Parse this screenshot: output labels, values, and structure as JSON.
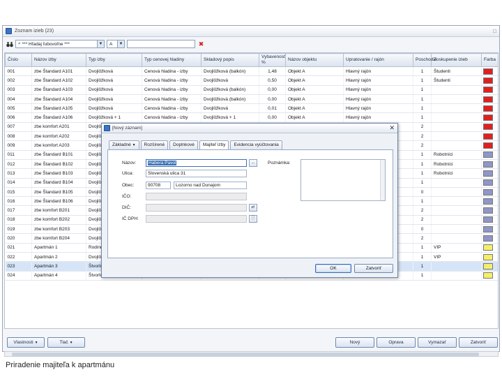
{
  "window": {
    "title": "Zoznam izieb (23)"
  },
  "toolbar": {
    "search_placeholder": "*** Hľadaj ľubovoľne ***",
    "filter_value": "A"
  },
  "grid": {
    "columns": [
      "Číslo",
      "Názov izby",
      "Typ izby",
      "Typ cenovej hladiny",
      "Skladový popis",
      "Vybavenosť %",
      "Názov objektu",
      "Upratovanie / rajón",
      "Poschodie",
      "Zoskupenie izieb",
      "Farba"
    ],
    "rows": [
      {
        "cislo": "001",
        "nazov": "zbe Štandard A101",
        "typ": "Dvojlôžková",
        "cenova": "Cenová hladina - izby",
        "popis": "Dvojlôžková (balkón)",
        "vybav": "1,48",
        "objekt": "Objekt A",
        "rajon": "Hlavný rajón",
        "posch": "1",
        "zosk": "Študenti",
        "farba": "#e02020"
      },
      {
        "cislo": "002",
        "nazov": "zbe Štandard A102",
        "typ": "Dvojlôžková",
        "cenova": "Cenová hladina - izby",
        "popis": "Dvojlôžková",
        "vybav": "0,50",
        "objekt": "Objekt A",
        "rajon": "Hlavný rajón",
        "posch": "1",
        "zosk": "Študenti",
        "farba": "#e02020"
      },
      {
        "cislo": "003",
        "nazov": "zbe Štandard A103",
        "typ": "Dvojlôžková",
        "cenova": "Cenová hladina - izby",
        "popis": "Dvojlôžková (balkón)",
        "vybav": "0,00",
        "objekt": "Objekt A",
        "rajon": "Hlavný rajón",
        "posch": "1",
        "zosk": "",
        "farba": "#e02020"
      },
      {
        "cislo": "004",
        "nazov": "zbe Štandard A104",
        "typ": "Dvojlôžková",
        "cenova": "Cenová hladina - izby",
        "popis": "Dvojlôžková (balkón)",
        "vybav": "0,00",
        "objekt": "Objekt A",
        "rajon": "Hlavný rajón",
        "posch": "1",
        "zosk": "",
        "farba": "#e02020"
      },
      {
        "cislo": "005",
        "nazov": "zbe Štandard A105",
        "typ": "Dvojlôžková",
        "cenova": "Cenová hladina - izby",
        "popis": "Dvojlôžková",
        "vybav": "0,01",
        "objekt": "Objekt A",
        "rajon": "Hlavný rajón",
        "posch": "1",
        "zosk": "",
        "farba": "#e02020"
      },
      {
        "cislo": "006",
        "nazov": "zbe Štandard A106",
        "typ": "Dvojlôžková + 1",
        "cenova": "Cenová hladina - izby",
        "popis": "Dvojlôžková + 1",
        "vybav": "0,00",
        "objekt": "Objekt A",
        "rajon": "Hlavný rajón",
        "posch": "1",
        "zosk": "",
        "farba": "#e02020"
      },
      {
        "cislo": "007",
        "nazov": "zbe komfort A201",
        "typ": "Dvojlôžková",
        "cenova": "",
        "popis": "",
        "vybav": "",
        "objekt": "",
        "rajon": "",
        "posch": "2",
        "zosk": "",
        "farba": "#e02020"
      },
      {
        "cislo": "008",
        "nazov": "zbe komfort A202",
        "typ": "Dvojlôžková",
        "cenova": "",
        "popis": "",
        "vybav": "",
        "objekt": "",
        "rajon": "",
        "posch": "2",
        "zosk": "",
        "farba": "#e02020"
      },
      {
        "cislo": "009",
        "nazov": "zbe komfort A203",
        "typ": "Dvojlôžková",
        "cenova": "",
        "popis": "",
        "vybav": "",
        "objekt": "",
        "rajon": "",
        "posch": "2",
        "zosk": "",
        "farba": "#e02020"
      },
      {
        "cislo": "011",
        "nazov": "zbe Štandard B101",
        "typ": "Dvojlôžková",
        "cenova": "",
        "popis": "",
        "vybav": "",
        "objekt": "",
        "rajon": "",
        "posch": "1",
        "zosk": "Robotníci",
        "farba": "#8f96c8"
      },
      {
        "cislo": "012",
        "nazov": "zbe Štandard B102",
        "typ": "Dvojlôžková",
        "cenova": "",
        "popis": "",
        "vybav": "",
        "objekt": "",
        "rajon": "",
        "posch": "1",
        "zosk": "Robotníci",
        "farba": "#8f96c8"
      },
      {
        "cislo": "013",
        "nazov": "zbe Štandard B103",
        "typ": "Dvojlôžková",
        "cenova": "",
        "popis": "",
        "vybav": "",
        "objekt": "",
        "rajon": "",
        "posch": "1",
        "zosk": "Robotníci",
        "farba": "#8f96c8"
      },
      {
        "cislo": "014",
        "nazov": "zbe Štandard B104",
        "typ": "Dvojlôžková",
        "cenova": "",
        "popis": "",
        "vybav": "",
        "objekt": "",
        "rajon": "",
        "posch": "1",
        "zosk": "",
        "farba": "#8f96c8"
      },
      {
        "cislo": "015",
        "nazov": "zbe Štandard B105",
        "typ": "Dvojlôžková",
        "cenova": "",
        "popis": "",
        "vybav": "",
        "objekt": "",
        "rajon": "",
        "posch": "0",
        "zosk": "",
        "farba": "#8f96c8"
      },
      {
        "cislo": "016",
        "nazov": "zbe Štandard B106",
        "typ": "Dvojlôžková",
        "cenova": "",
        "popis": "",
        "vybav": "",
        "objekt": "",
        "rajon": "",
        "posch": "1",
        "zosk": "",
        "farba": "#8f96c8"
      },
      {
        "cislo": "017",
        "nazov": "zbe komfort B201",
        "typ": "Dvojlôžková",
        "cenova": "",
        "popis": "",
        "vybav": "",
        "objekt": "",
        "rajon": "",
        "posch": "2",
        "zosk": "",
        "farba": "#8f96c8"
      },
      {
        "cislo": "018",
        "nazov": "zbe komfort B202",
        "typ": "Dvojlôžková",
        "cenova": "",
        "popis": "",
        "vybav": "",
        "objekt": "",
        "rajon": "",
        "posch": "2",
        "zosk": "",
        "farba": "#8f96c8"
      },
      {
        "cislo": "019",
        "nazov": "zbe komfort B203",
        "typ": "Dvojlôžková",
        "cenova": "",
        "popis": "",
        "vybav": "",
        "objekt": "",
        "rajon": "",
        "posch": "0",
        "zosk": "",
        "farba": "#8f96c8"
      },
      {
        "cislo": "020",
        "nazov": "zbe komfort B204",
        "typ": "Dvojlôžková",
        "cenova": "",
        "popis": "",
        "vybav": "",
        "objekt": "",
        "rajon": "",
        "posch": "2",
        "zosk": "",
        "farba": "#8f96c8"
      },
      {
        "cislo": "021",
        "nazov": "Apartmán 1",
        "typ": "Rodinná",
        "cenova": "",
        "popis": "",
        "vybav": "",
        "objekt": "",
        "rajon": "",
        "posch": "1",
        "zosk": "VIP",
        "farba": "#f4ef6a"
      },
      {
        "cislo": "022",
        "nazov": "Apartmán 2",
        "typ": "Dvojlôžková",
        "cenova": "",
        "popis": "",
        "vybav": "",
        "objekt": "",
        "rajon": "",
        "posch": "1",
        "zosk": "VIP",
        "farba": "#f4ef6a"
      },
      {
        "cislo": "023",
        "nazov": "Apartmán 3",
        "typ": "Štvorlôžková",
        "cenova": "",
        "popis": "",
        "vybav": "",
        "objekt": "",
        "rajon": "",
        "posch": "1",
        "zosk": "",
        "farba": "#f4ef6a"
      },
      {
        "cislo": "024",
        "nazov": "Apartmán 4",
        "typ": "Štvorlôžková",
        "cenova": "",
        "popis": "",
        "vybav": "",
        "objekt": "",
        "rajon": "",
        "posch": "1",
        "zosk": "",
        "farba": "#f4ef6a"
      }
    ]
  },
  "bottom": {
    "vlastnosti": "Vlastnosti",
    "tlac": "Tlač",
    "novy": "Nový",
    "oprava": "Oprava",
    "vymazat": "Vymazať",
    "zatvorit": "Zatvoriť"
  },
  "dialog": {
    "title": "[Nový záznam]",
    "tabs": [
      "Základné",
      "Rozšírené",
      "Doplnkové",
      "Majiteľ izby",
      "Evidencia vyúčtovania"
    ],
    "fields": {
      "nazov_label": "Názov:",
      "nazov_value": "Habera Pavol",
      "ulica_label": "Ulica:",
      "ulica_value": "Slovenská ulica 31",
      "obec_label": "Obec:",
      "psc_value": "90708",
      "obec_value": "Lozorno nad Dunajom",
      "ico_label": "IČO:",
      "dic_label": "DIČ:",
      "icdph_label": "IČ DPH:",
      "poznamka_label": "Poznámka:"
    },
    "ok": "OK",
    "zatvorit": "Zatvoriť"
  },
  "caption": "Priradenie majiteľa k apartmánu"
}
